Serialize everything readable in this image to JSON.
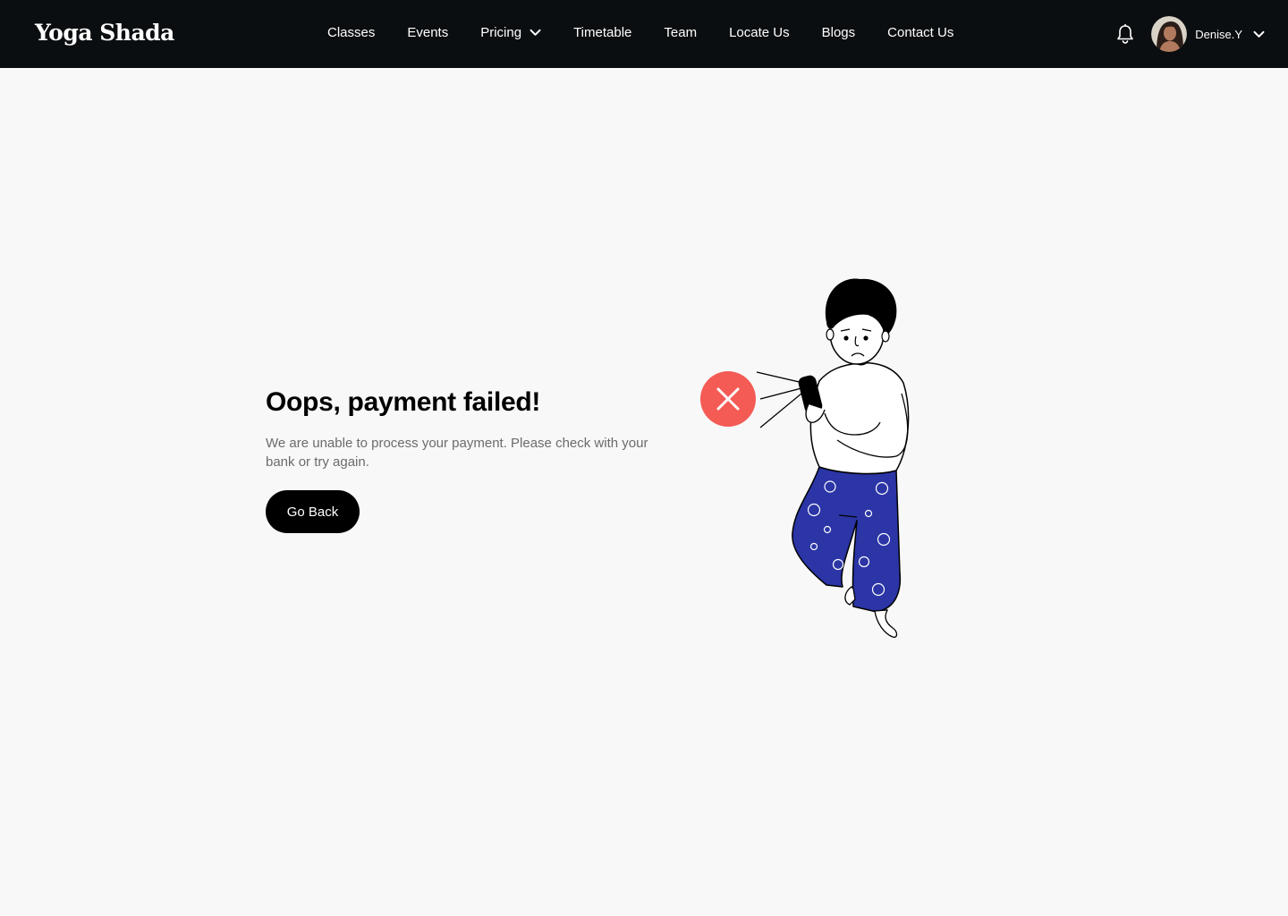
{
  "header": {
    "logo": "Yoga Shada",
    "nav": [
      {
        "label": "Classes",
        "name": "nav-classes"
      },
      {
        "label": "Events",
        "name": "nav-events"
      },
      {
        "label": "Pricing",
        "name": "nav-pricing",
        "dropdown": true
      },
      {
        "label": "Timetable",
        "name": "nav-timetable"
      },
      {
        "label": "Team",
        "name": "nav-team"
      },
      {
        "label": "Locate Us",
        "name": "nav-locate-us"
      },
      {
        "label": "Blogs",
        "name": "nav-blogs"
      },
      {
        "label": "Contact Us",
        "name": "nav-contact-us"
      }
    ],
    "user": {
      "name": "Denise.Y",
      "notification_icon": "bell-icon",
      "menu_icon": "chevron-down-icon"
    }
  },
  "main": {
    "title": "Oops, payment failed!",
    "message": "We are unable to process your payment. Please check with your bank or try again.",
    "button_label": "Go Back",
    "status_icon": "close-icon"
  },
  "colors": {
    "topbar": "#0b0e10",
    "error": "#f45b55",
    "pants": "#2b35a6",
    "button": "#000000",
    "message_text": "#6b6b6b"
  }
}
